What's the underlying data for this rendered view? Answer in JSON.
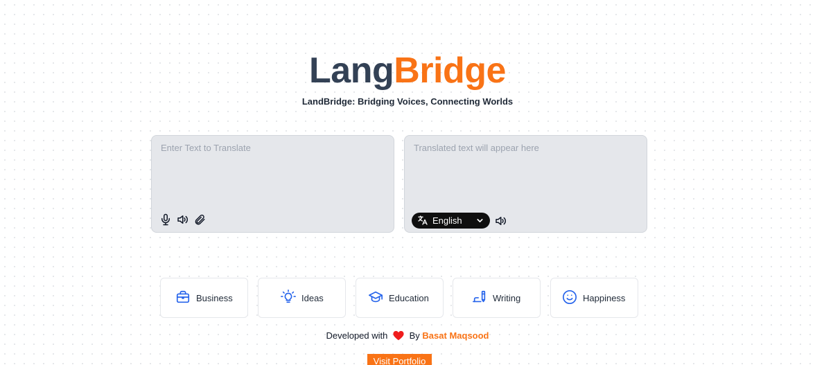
{
  "header": {
    "title_part1": "Lang",
    "title_part2": "Bridge",
    "subtitle": "LandBridge: Bridging Voices, Connecting Worlds"
  },
  "input_panel": {
    "placeholder": "Enter Text to Translate",
    "value": "",
    "icons": [
      "microphone-icon",
      "speaker-icon",
      "paperclip-icon"
    ]
  },
  "output_panel": {
    "placeholder": "Translated text will appear here",
    "value": "",
    "language": "English",
    "icons": [
      "translate-icon",
      "chevron-down-icon",
      "speaker-icon"
    ]
  },
  "categories": [
    {
      "label": "Business",
      "icon": "briefcase-icon"
    },
    {
      "label": "Ideas",
      "icon": "lightbulb-icon"
    },
    {
      "label": "Education",
      "icon": "graduation-cap-icon"
    },
    {
      "label": "Writing",
      "icon": "pen-writing-icon"
    },
    {
      "label": "Happiness",
      "icon": "smile-icon"
    }
  ],
  "footer": {
    "prefix": "Developed with",
    "by": "By",
    "author": "Basat Maqsood",
    "portfolio_button": "Visit Portfolio"
  },
  "colors": {
    "accent": "#f97316",
    "title_dark": "#334155",
    "icon_blue": "#2563eb",
    "panel_bg": "#e5e7eb",
    "heart": "#ef1d1d"
  }
}
